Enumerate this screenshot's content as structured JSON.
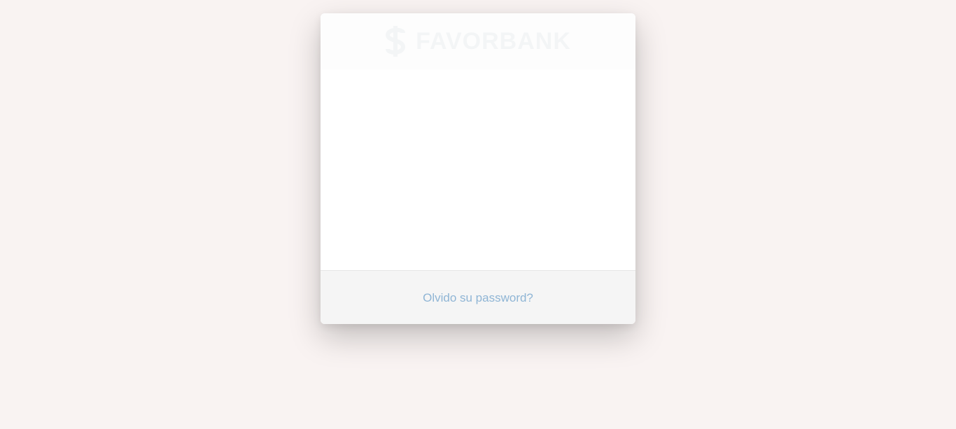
{
  "login": {
    "brand": {
      "name": "FAVORBANK",
      "logo_icon": "dollar-icon"
    },
    "forgot_password_link": "Olvido su password?"
  },
  "colors": {
    "page_background": "#f9f3f2",
    "card_background": "#ffffff",
    "footer_background": "#f5f5f5",
    "link": "#8fb5d5"
  }
}
